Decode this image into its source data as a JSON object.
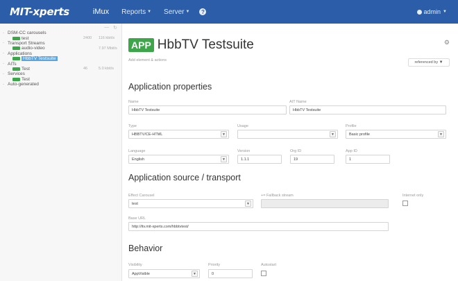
{
  "navbar": {
    "brand": "MIT-xperts",
    "imux": "iMux",
    "reports": "Reports",
    "server": "Server",
    "help": "?",
    "user": "admin"
  },
  "sidebar": {
    "items": [
      {
        "label": "DSM-CC carousels",
        "level": 0
      },
      {
        "label": "test",
        "level": 1,
        "meta1": "2400",
        "meta2": "116 kbit/s"
      },
      {
        "label": "Transport Streams",
        "level": 0
      },
      {
        "label": "audio-video",
        "level": 1,
        "meta1": "",
        "meta2": "7.97 Mbit/s"
      },
      {
        "label": "Applications",
        "level": 0
      },
      {
        "label": "HbbTV Testsuite",
        "level": 1,
        "selected": true
      },
      {
        "label": "AITs",
        "level": 0
      },
      {
        "label": "Test",
        "level": 1,
        "meta1": "46",
        "meta2": "5.0 kbit/s"
      },
      {
        "label": "Services",
        "level": 0
      },
      {
        "label": "Test",
        "level": 1
      },
      {
        "label": "Auto-generated",
        "level": 0
      }
    ]
  },
  "header": {
    "badge": "APP",
    "title": "HbbTV Testsuite",
    "subtitle": "Add element & actions",
    "referenced_by": "referenced by"
  },
  "properties": {
    "section": "Application properties",
    "name_label": "Name",
    "name_value": "HbbTV Testsuite",
    "ait_name_label": "AIT Name",
    "ait_name_value": "HbbTV Testsuite",
    "type_label": "Type",
    "type_value": "HBBTV/CE-HTML",
    "usage_label": "Usage",
    "usage_value": "",
    "profile_label": "Profile",
    "profile_value": "Basic profile",
    "language_label": "Language",
    "language_value": "English",
    "version_label": "Version",
    "version_value": "1.1.1",
    "org_label": "Org ID",
    "org_value": "19",
    "app_label": "App ID",
    "app_value": "1"
  },
  "transport": {
    "section": "Application source / transport",
    "carousel_label": "Effect Carousel",
    "carousel_value": "test",
    "fallback_label": "+= Fallback stream",
    "fallback_value": "",
    "internet_label": "Internet only",
    "url_label": "Base URL",
    "url_value": "http://itv.mit-xperts.com/hbbtvtest/"
  },
  "behavior": {
    "section": "Behavior",
    "visibility_label": "Visibility",
    "visibility_value": "AppVisible",
    "priority_label": "Priority",
    "priority_value": "0",
    "autostart_label": "Autostart"
  }
}
